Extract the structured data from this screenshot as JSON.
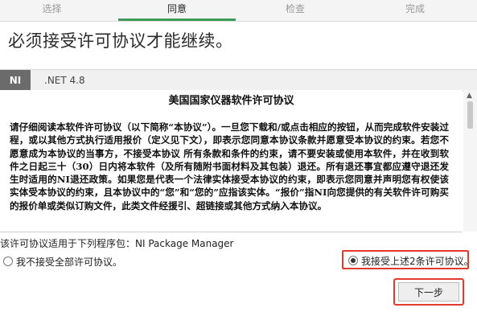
{
  "steps": [
    {
      "label": "选择"
    },
    {
      "label": "同意"
    },
    {
      "label": "检查"
    },
    {
      "label": "完成"
    }
  ],
  "active_step": 1,
  "heading": "必须接受许可协议才能继续。",
  "product_tabs": [
    {
      "label": "NI"
    },
    {
      "label": ".NET 4.8"
    }
  ],
  "license": {
    "title": "美国国家仪器软件许可协议",
    "body": "请仔细阅读本软件许可协议（以下简称“本协议”）。一旦您下载和/或点击相应的按钮，从而完成软件安装过程，或以其他方式执行适用报价（定义见下文），即表示您同意本协议条款并愿意受本协议的约束。若您不愿意成为本协议的当事方，不接受本协议 所有条款和条件的约束，请不要安装或使用本软件，并在收到软件之日起三十（30）日内将本软件（及所有随附书面材料及其包装）退还。所有退还事宜都应遵守退还发生时适用的NI退还政策。如果您是代表一个法律实体接受本协议的约束，即表示您同意并声明您有权使该实体受本协议的约束，且本协议中的“您”和“您的”应指该实体。“报价”指NI向您提供的有关软件许可购买的报价单或类似订购文件，此类文件经援引、超链接或其他方式纳入本协议。"
  },
  "applies_text": "该许可协议适用于下列程序包：NI Package Manager",
  "decline_label": "我不接受全部许可协议。",
  "accept_label": "我接受上述2条许可协议。",
  "accept_selected": true,
  "next_label": "下一步",
  "colors": {
    "active_step_bar": "#3d9b5c",
    "highlight_box": "#e33a2f",
    "ni_tab_bg": "#6b6b6b"
  },
  "icons": {
    "scroll_up": "triangle-up-icon"
  }
}
